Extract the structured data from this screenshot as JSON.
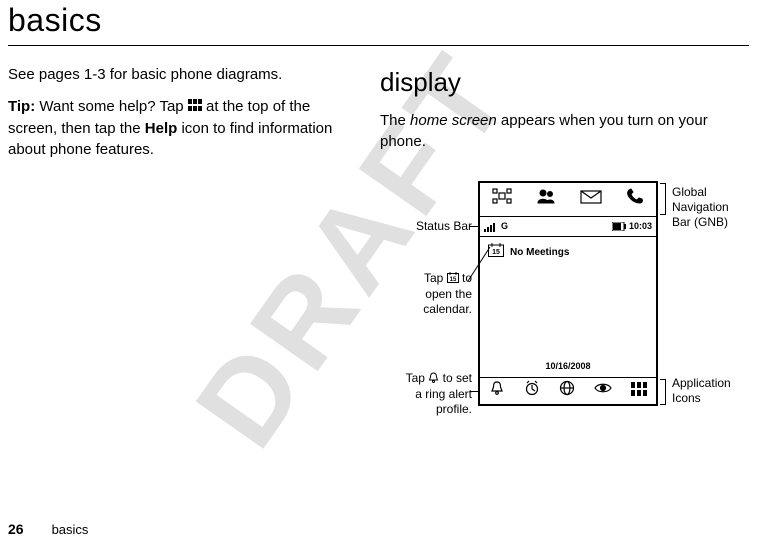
{
  "title": "basics",
  "left": {
    "line1": "See pages 1-3 for basic phone diagrams.",
    "tip_label": "Tip:",
    "tip_part1": " Want some help? Tap ",
    "tip_part2": " at the top of the screen, then tap the ",
    "help_word": "Help",
    "tip_part3": " icon to find information about phone features."
  },
  "right": {
    "section_title": "display",
    "body_part1": "The ",
    "body_italic": "home screen",
    "body_part2": " appears when you turn on your phone."
  },
  "phone": {
    "status_g": "G",
    "status_time": "10:03",
    "no_meetings": "No Meetings",
    "date": "10/16/2008"
  },
  "labels": {
    "status_bar": "Status Bar",
    "gnb_l1": "Global",
    "gnb_l2": "Navigation",
    "gnb_l3": "Bar (GNB)",
    "cal_l1": "Tap ",
    "cal_l2": " to",
    "cal_l3": "open the",
    "cal_l4": "calendar.",
    "ring_l1": "Tap ",
    "ring_l2": " to set",
    "ring_l3": "a ring alert",
    "ring_l4": "profile.",
    "app_l1": "Application",
    "app_l2": "Icons"
  },
  "watermark": "DRAFT",
  "footer": {
    "page": "26",
    "label": "basics"
  }
}
